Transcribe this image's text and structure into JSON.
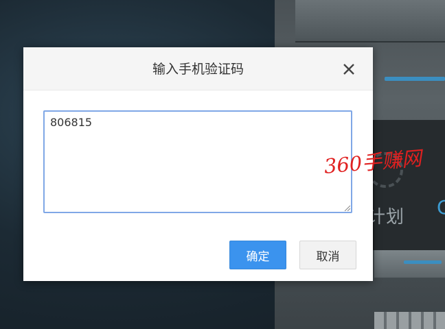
{
  "dialog": {
    "title": "输入手机验证码",
    "close_icon": "close-icon",
    "code_value": "806815",
    "confirm_label": "确定",
    "cancel_label": "取消"
  },
  "background": {
    "panel_text": "计划",
    "panel_letter": "C"
  },
  "watermark": {
    "text": "360手赚网",
    "color": "#e02020"
  },
  "colors": {
    "primary": "#3b93ee",
    "input_border": "#7fa7e6"
  }
}
